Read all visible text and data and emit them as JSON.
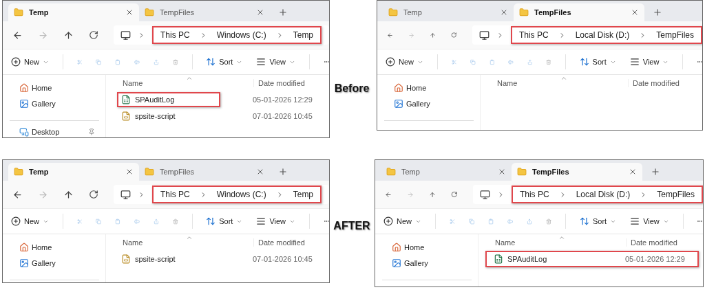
{
  "panels": [
    {
      "tabs": [
        {
          "label": "Temp",
          "selected": true
        },
        {
          "label": "TempFiles",
          "selected": false
        }
      ],
      "path": {
        "segments": [
          "This PC",
          "Windows (C:)",
          "Temp"
        ],
        "highlighted": true
      },
      "toolbar": {
        "new": "New",
        "sort": "Sort",
        "view": "View"
      },
      "sidebar": [
        {
          "label": "Home",
          "kind": "home",
          "pinned": false
        },
        {
          "label": "Gallery",
          "kind": "gallery",
          "pinned": false
        },
        {
          "label": "Desktop",
          "kind": "desktop",
          "pinned": true
        }
      ],
      "columns": [
        "Name",
        "Date modified"
      ],
      "files": [
        {
          "name": "SPAuditLog",
          "date": "05-01-2026 12:29",
          "kind": "log",
          "highlighted": true
        },
        {
          "name": "spsite-script",
          "date": "07-01-2026 10:45",
          "kind": "script",
          "highlighted": false
        }
      ]
    },
    {
      "tabs": [
        {
          "label": "Temp",
          "selected": false
        },
        {
          "label": "TempFiles",
          "selected": true
        }
      ],
      "path": {
        "segments": [
          "This PC",
          "Local Disk (D:)",
          "TempFiles"
        ],
        "highlighted": true
      },
      "toolbar": {
        "new": "New",
        "sort": "Sort",
        "view": "View"
      },
      "sidebar": [
        {
          "label": "Home",
          "kind": "home",
          "pinned": false
        },
        {
          "label": "Gallery",
          "kind": "gallery",
          "pinned": false
        }
      ],
      "columns": [
        "Name",
        "Date modified"
      ]
    },
    {
      "tabs": [
        {
          "label": "Temp",
          "selected": true
        },
        {
          "label": "TempFiles",
          "selected": false
        }
      ],
      "path": {
        "segments": [
          "This PC",
          "Windows (C:)",
          "Temp"
        ],
        "highlighted": true
      },
      "toolbar": {
        "new": "New",
        "sort": "Sort",
        "view": "View"
      },
      "sidebar": [
        {
          "label": "Home",
          "kind": "home",
          "pinned": false
        },
        {
          "label": "Gallery",
          "kind": "gallery",
          "pinned": false
        }
      ],
      "columns": [
        "Name",
        "Date modified"
      ],
      "files": [
        {
          "name": "spsite-script",
          "date": "07-01-2026 10:45",
          "kind": "script",
          "highlighted": false
        }
      ]
    },
    {
      "tabs": [
        {
          "label": "Temp",
          "selected": false
        },
        {
          "label": "TempFiles",
          "selected": true
        }
      ],
      "path": {
        "segments": [
          "This PC",
          "Local Disk (D:)",
          "TempFiles"
        ],
        "highlighted": true
      },
      "toolbar": {
        "new": "New",
        "sort": "Sort",
        "view": "View"
      },
      "sidebar": [
        {
          "label": "Home",
          "kind": "home",
          "pinned": false
        },
        {
          "label": "Gallery",
          "kind": "gallery",
          "pinned": false
        }
      ],
      "columns": [
        "Name",
        "Date modified"
      ],
      "files": [
        {
          "name": "SPAuditLog",
          "date": "05-01-2026 12:29",
          "kind": "log",
          "highlighted": true
        }
      ]
    }
  ],
  "labels": [
    "Before",
    "AFTER"
  ]
}
